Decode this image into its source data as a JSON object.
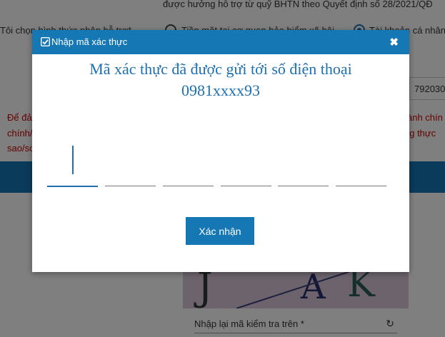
{
  "background": {
    "top_line": "được hưởng hỗ trợ từ quỹ BHTN theo Quyết định số 28/2021/QĐ",
    "method_label": "Tôi chọn hình thức nhận hỗ trợ*",
    "option_cash": "Tiền mặt tại cơ quan bảo hiểm xã hội",
    "option_account": "Tài khoản cá nhân",
    "field_value": "792030",
    "red_left_1": "Để đả",
    "red_left_2": "chính/",
    "red_left_3": "sao/sc",
    "red_right_1": "ành chín",
    "red_right_2": "ng thực",
    "captcha_chars": [
      "J",
      "A",
      "K"
    ],
    "captcha_placeholder": "Nhập lại mã kiểm tra trên *",
    "refresh_glyph": "↻"
  },
  "modal": {
    "title": "Nhập mã xác thực",
    "close_glyph": "✖",
    "message_line1": "Mã xác thực đã được gửi tới số điện thoại",
    "message_line2": "0981xxxx93",
    "otp_values": [
      "",
      "",
      "",
      "",
      "",
      ""
    ],
    "confirm_label": "Xác nhận"
  },
  "colors": {
    "primary": "#1577b4",
    "accent_text": "#1e6fb0",
    "overlay": "rgba(0,0,0,0.5)",
    "warning_text": "#cc0000"
  }
}
